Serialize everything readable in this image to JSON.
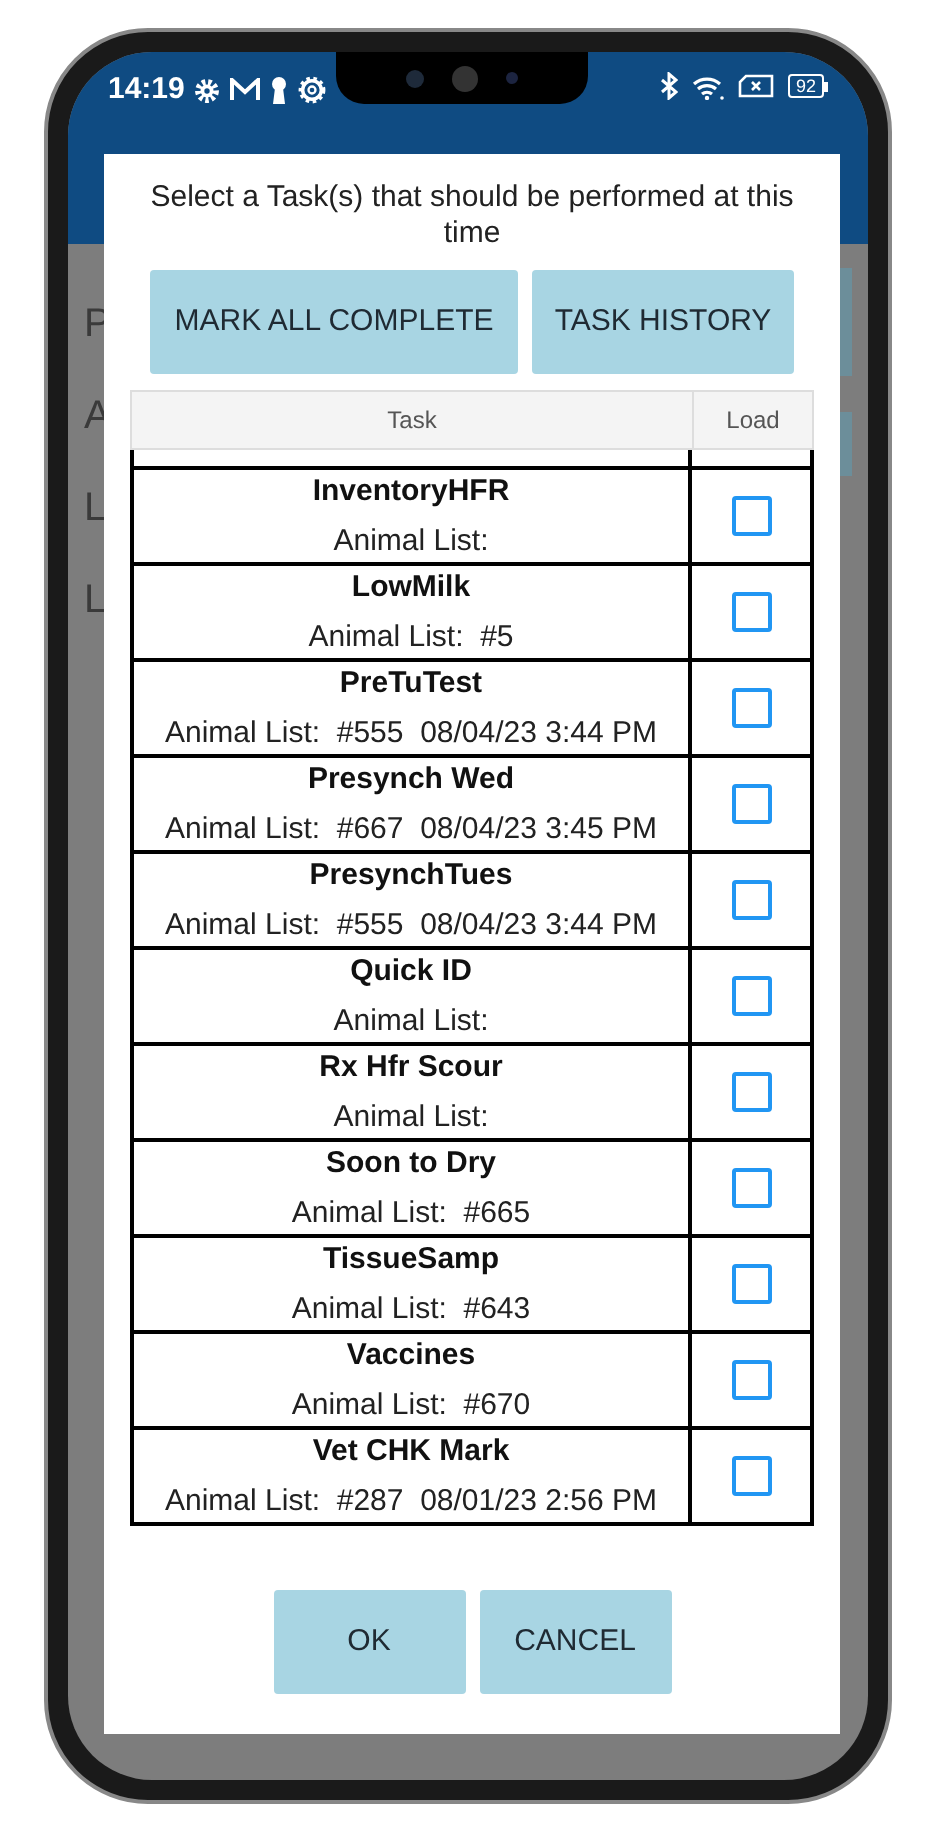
{
  "status_bar": {
    "time": "14:19",
    "battery": "92"
  },
  "background": {
    "texts": [
      "P",
      "A",
      "L",
      "L"
    ]
  },
  "dialog": {
    "title": "Select a Task(s) that should be performed at this time",
    "actions": [
      "MARK ALL COMPLETE",
      "TASK HISTORY"
    ],
    "table": {
      "columns": [
        "Task",
        "Load"
      ],
      "rows": [
        {
          "name": "InventoryHFR",
          "list": "Animal List:",
          "checked": false
        },
        {
          "name": "LowMilk",
          "list": "Animal List:  #5",
          "checked": false
        },
        {
          "name": "PreTuTest",
          "list": "Animal List:  #555  08/04/23 3:44 PM",
          "checked": false
        },
        {
          "name": "Presynch Wed",
          "list": "Animal List:  #667  08/04/23 3:45 PM",
          "checked": false
        },
        {
          "name": "PresynchTues",
          "list": "Animal List:  #555  08/04/23 3:44 PM",
          "checked": false
        },
        {
          "name": "Quick ID",
          "list": "Animal List:",
          "checked": false
        },
        {
          "name": "Rx Hfr Scour",
          "list": "Animal List:",
          "checked": false
        },
        {
          "name": "Soon to Dry",
          "list": "Animal List:  #665",
          "checked": false
        },
        {
          "name": "TissueSamp",
          "list": "Animal List:  #643",
          "checked": false
        },
        {
          "name": "Vaccines",
          "list": "Animal List:  #670",
          "checked": false
        },
        {
          "name": "Vet CHK Mark",
          "list": "Animal List:  #287  08/01/23 2:56 PM",
          "checked": false
        }
      ]
    },
    "buttons": [
      "OK",
      "CANCEL"
    ]
  }
}
